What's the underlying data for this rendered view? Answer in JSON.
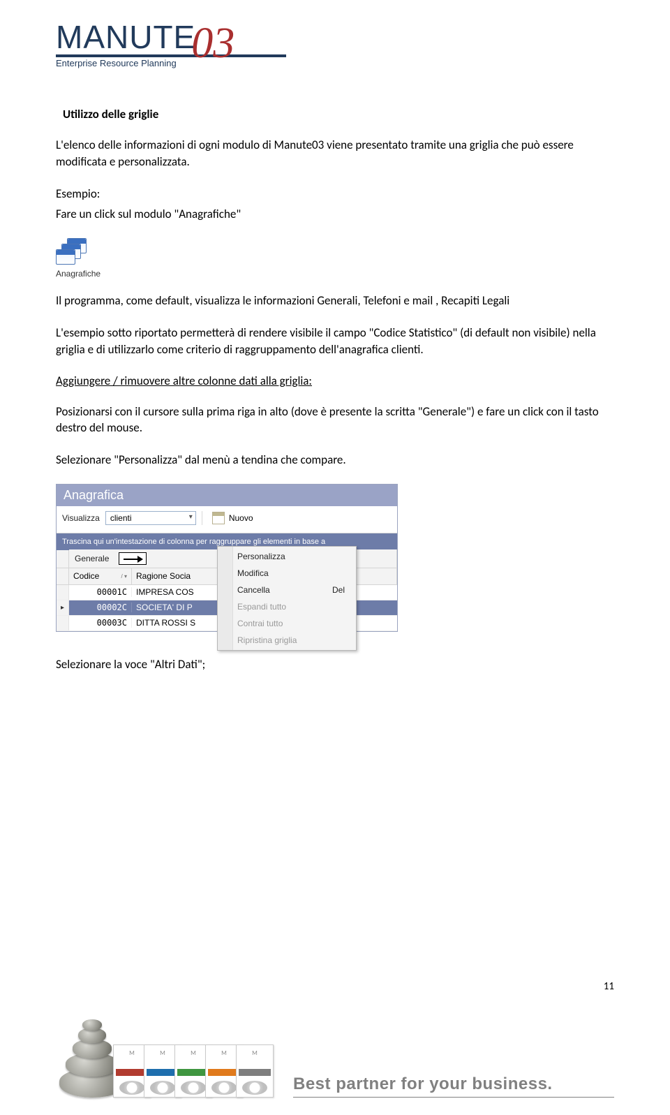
{
  "logo": {
    "main": "MANUTE",
    "suffix": "03",
    "sub": "Enterprise Resource Planning"
  },
  "heading": "Utilizzo delle griglie",
  "para1": "L'elenco delle informazioni di ogni modulo di Manute03 viene presentato tramite una griglia che può essere modificata e personalizzata.",
  "para2a": "Esempio:",
  "para2b": "Fare un click sul modulo \"Anagrafiche\"",
  "anag_icon_label": "Anagrafiche",
  "para3": "Il programma, come default, visualizza le informazioni Generali, Telefoni e mail , Recapiti Legali",
  "para4": "L'esempio sotto riportato permetterà  di rendere visibile il campo \"Codice Statistico\" (di default non visibile) nella griglia e di utilizzarlo come criterio di raggruppamento dell'anagrafica clienti.",
  "para5_underline": "Aggiungere / rimuovere altre colonne dati alla griglia:",
  "para6": "Posizionarsi con il cursore sulla prima riga in alto (dove è presente la scritta \"Generale\")  e fare un click con il tasto destro del mouse.",
  "para7": "Selezionare \"Personalizza\" dal menù a tendina che compare.",
  "app": {
    "title": "Anagrafica",
    "toolbar": {
      "visualizza": "Visualizza",
      "dropdown": "clienti",
      "nuovo": "Nuovo"
    },
    "groupbar": "Trascina qui un'intestazione di colonna per raggruppare gli elementi in base a",
    "col_generale": "Generale",
    "col_codice": "Codice",
    "col_ragione": "Ragione Socia",
    "rows": [
      {
        "codice": "00001C",
        "ragione": "IMPRESA COS"
      },
      {
        "codice": "00002C",
        "ragione": "SOCIETA' DI P"
      },
      {
        "codice": "00003C",
        "ragione": "DITTA ROSSI S"
      }
    ],
    "ctx": {
      "personalizza": "Personalizza",
      "modifica": "Modifica",
      "cancella": "Cancella",
      "cancella_sc": "Del",
      "espandi": "Espandi tutto",
      "contrai": "Contrai tutto",
      "ripristina": "Ripristina griglia"
    }
  },
  "para8": "Selezionare la voce \"Altri Dati\";",
  "page_num": "11",
  "footer_tag": "Best partner for your business."
}
